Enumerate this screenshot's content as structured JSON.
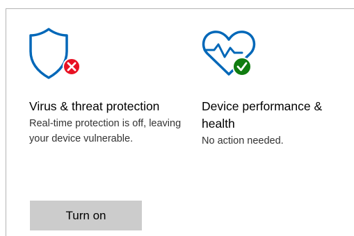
{
  "colors": {
    "icon_blue": "#0067b8",
    "error_red": "#e81123",
    "ok_green": "#107c10",
    "button_bg": "#cccccc"
  },
  "tiles": [
    {
      "icon": "shield-error-icon",
      "title": "Virus & threat protection",
      "description": "Real-time protection is off, leaving your device vulnerable.",
      "button_label": "Turn on"
    },
    {
      "icon": "heart-check-icon",
      "title": "Device performance & health",
      "description": "No action needed."
    }
  ]
}
